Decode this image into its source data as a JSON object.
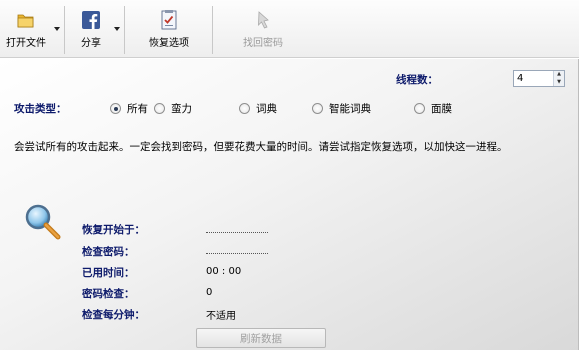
{
  "toolbar": {
    "open_file": "打开文件",
    "share": "分享",
    "recovery_options": "恢复选项",
    "recover_password": "找回密码"
  },
  "threads": {
    "label": "线程数：",
    "value": "4"
  },
  "attack": {
    "label": "攻击类型：",
    "options": [
      "所有",
      "蛮力",
      "词典",
      "智能词典",
      "面膜"
    ],
    "selected": "所有"
  },
  "description": "会尝试所有的攻击起来。一定会找到密码，但要花费大量的时间。请尝试指定恢复选项，以加快这一进程。",
  "stats": {
    "start_label": "恢复开始于：",
    "check_label": "检查密码：",
    "elapsed_label": "已用时间：",
    "elapsed_value": "00 : 00",
    "checked_label": "密码检查：",
    "checked_value": "0",
    "per_minute_label": "检查每分钟：",
    "per_minute_value": "不适用"
  },
  "refresh_button": "刷新数据",
  "colors": {
    "label_blue": "#0d1a6b",
    "disabled": "#9a9a9a"
  }
}
